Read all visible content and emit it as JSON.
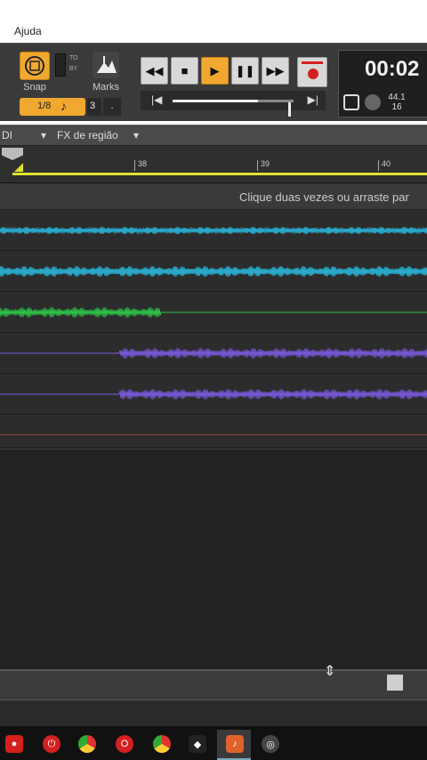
{
  "menu": {
    "help_label": "Ajuda"
  },
  "toolbar": {
    "snap_label": "Snap",
    "marks_label": "Marks",
    "toby_to": "TO",
    "toby_by": "BY",
    "snap_value": "1/8",
    "snap_number": "3",
    "snap_dot": "."
  },
  "transport": {
    "time": "00:02",
    "sample_rate": "44.1",
    "bit_depth": "16"
  },
  "strip": {
    "midi_label": "DI",
    "fx_label": "FX de região"
  },
  "ruler": {
    "marks": [
      "38",
      "39",
      "40"
    ]
  },
  "hint": {
    "text": "Clique duas vezes ou arraste par"
  },
  "tracks": [
    {
      "color": "#29a8c8"
    },
    {
      "color": "#29a8c8"
    },
    {
      "color": "#2ec84a"
    },
    {
      "color": "#7b5ae0"
    },
    {
      "color": "#7b5ae0"
    }
  ],
  "taskbar": {
    "icons": [
      "record-app-icon",
      "power-icon",
      "chrome-icon",
      "opera-icon",
      "chrome-icon",
      "inkscape-icon",
      "daw-icon",
      "obs-icon"
    ]
  }
}
